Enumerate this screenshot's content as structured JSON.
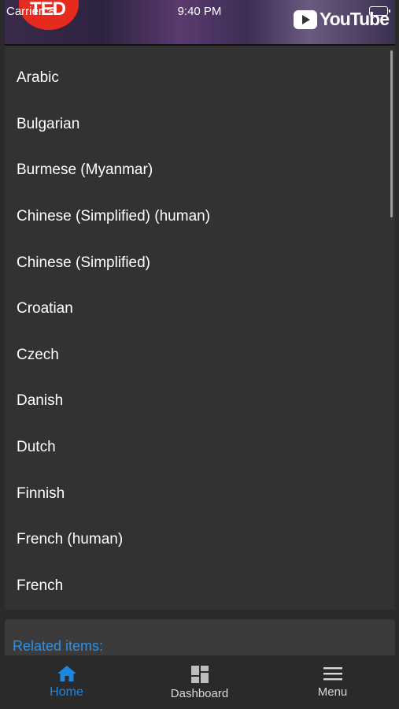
{
  "status_bar": {
    "carrier": "Carrier",
    "time": "9:40 PM"
  },
  "video": {
    "logo_text": "TED",
    "brand_text": "YouTube"
  },
  "languages": [
    "Arabic",
    "Bulgarian",
    "Burmese (Myanmar)",
    "Chinese (Simplified) (human)",
    "Chinese (Simplified)",
    "Croatian",
    "Czech",
    "Danish",
    "Dutch",
    "Finnish",
    "French (human)",
    "French"
  ],
  "related": {
    "label": "Related items:"
  },
  "tabs": [
    {
      "label": "Home",
      "icon": "home-icon",
      "active": true
    },
    {
      "label": "Dashboard",
      "icon": "dashboard-icon",
      "active": false
    },
    {
      "label": "Menu",
      "icon": "menu-icon",
      "active": false
    }
  ],
  "colors": {
    "accent": "#1f86e0",
    "list_bg": "#323232",
    "page_bg": "#2a2a2a"
  }
}
